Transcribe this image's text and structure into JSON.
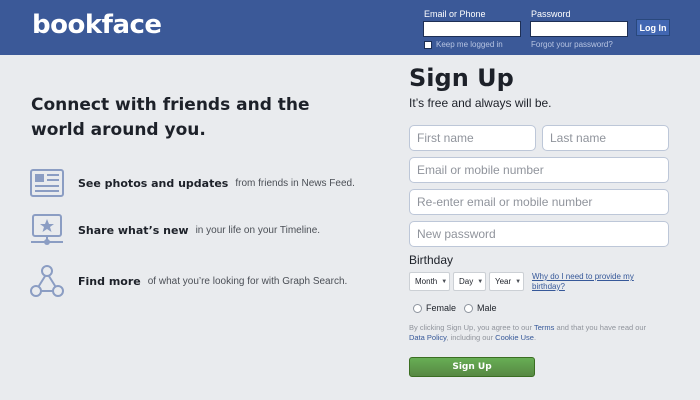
{
  "header": {
    "logo": "bookface",
    "email_label": "Email or Phone",
    "password_label": "Password",
    "login_button": "Log In",
    "keep_logged_in": "Keep me logged in",
    "forgot_password": "Forgot your password?",
    "bg_color": "#3b5998"
  },
  "left": {
    "headline": "Connect with friends and the world around you.",
    "features": [
      {
        "title": "See photos and updates",
        "desc": "from friends in News Feed.",
        "icon": "news-feed-icon"
      },
      {
        "title": "Share what’s new",
        "desc": "in your life on your Timeline.",
        "icon": "timeline-icon"
      },
      {
        "title": "Find more",
        "desc": "of what you’re looking for with Graph Search.",
        "icon": "graph-search-icon"
      }
    ]
  },
  "signup": {
    "title": "Sign Up",
    "subtitle": "It’s free and always will be.",
    "first_name_placeholder": "First name",
    "last_name_placeholder": "Last name",
    "email_placeholder": "Email or mobile number",
    "reenter_email_placeholder": "Re-enter email or mobile number",
    "password_placeholder": "New password",
    "birthday_label": "Birthday",
    "month": "Month",
    "day": "Day",
    "year": "Year",
    "why_birthday": "Why do I need to provide my birthday?",
    "female": "Female",
    "male": "Male",
    "terms_prefix": "By clicking Sign Up, you agree to our ",
    "terms_link": "Terms",
    "terms_mid": " and that you have read our ",
    "data_policy_link": "Data Policy",
    "terms_mid2": ", including our ",
    "cookie_link": "Cookie Use",
    "terms_suffix": ".",
    "button": "Sign Up",
    "button_color": "#5fa046"
  }
}
